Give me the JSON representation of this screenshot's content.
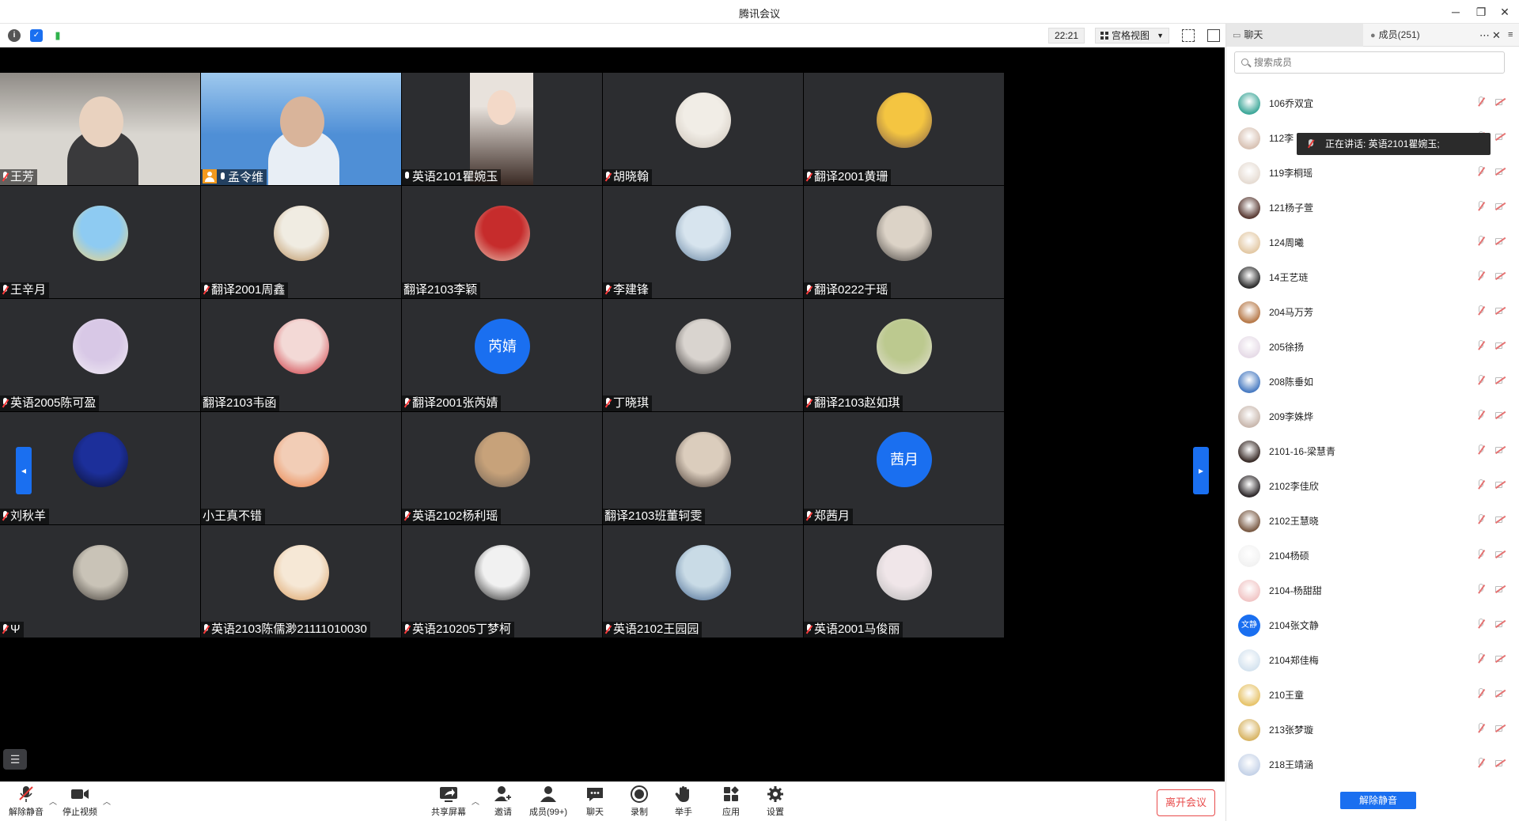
{
  "window": {
    "title": "腾讯会议"
  },
  "toolbar": {
    "clock": "22:21",
    "view_mode": "宫格视图"
  },
  "tiles": [
    {
      "name": "王芳",
      "mic": "off",
      "kind": "camera",
      "colors": [
        "#d9d6d0",
        "#8f8b86"
      ]
    },
    {
      "name": "孟令维",
      "mic": "on",
      "host": true,
      "kind": "camera",
      "colors": [
        "#4f8fd6",
        "#9fc9ee"
      ]
    },
    {
      "name": "英语2101瞿婉玉",
      "mic": "on",
      "kind": "camera",
      "active": true,
      "colors": [
        "#e8e2dc",
        "#3a2a24"
      ]
    },
    {
      "name": "胡晓翰",
      "mic": "off",
      "kind": "avatar",
      "colors": [
        "#f1ede6",
        "#c9bfb4"
      ]
    },
    {
      "name": "翻译2001黄珊",
      "mic": "off",
      "kind": "avatar",
      "colors": [
        "#f4c541",
        "#7b5a4a"
      ]
    },
    {
      "name": "王辛月",
      "mic": "off",
      "kind": "avatar",
      "colors": [
        "#8ecbf2",
        "#f6d57b"
      ]
    },
    {
      "name": "翻译2001周鑫",
      "mic": "off",
      "kind": "avatar",
      "colors": [
        "#f0ece2",
        "#b78a54"
      ]
    },
    {
      "name": "翻译2103李颖",
      "mic": "none",
      "kind": "avatar",
      "colors": [
        "#c62c2c",
        "#e9c9b8"
      ]
    },
    {
      "name": "李建锋",
      "mic": "off",
      "kind": "avatar",
      "colors": [
        "#d7e4ee",
        "#5b7b9a"
      ]
    },
    {
      "name": "翻译0222于瑶",
      "mic": "off",
      "kind": "avatar",
      "colors": [
        "#dcd3c7",
        "#3e3a37"
      ]
    },
    {
      "name": "英语2005陈可盈",
      "mic": "off",
      "kind": "avatar",
      "colors": [
        "#d8c8e6",
        "#f2eef4"
      ]
    },
    {
      "name": "翻译2103韦函",
      "mic": "none",
      "kind": "avatar",
      "colors": [
        "#f3d9d6",
        "#c8202a"
      ]
    },
    {
      "name": "翻译2001张芮婧",
      "mic": "off",
      "kind": "text",
      "text": "芮婧",
      "colors": [
        "#1a6ff0",
        "#1a6ff0"
      ]
    },
    {
      "name": "丁晓琪",
      "mic": "off",
      "kind": "avatar",
      "colors": [
        "#d9d4cf",
        "#2a2625"
      ]
    },
    {
      "name": "翻译2103赵如琪",
      "mic": "off",
      "kind": "avatar",
      "colors": [
        "#bcc98f",
        "#e8e2da"
      ]
    },
    {
      "name": "刘秋羊",
      "mic": "off",
      "kind": "avatar",
      "colors": [
        "#1c2f9a",
        "#0b0f2a"
      ]
    },
    {
      "name": "小王真不错",
      "mic": "none",
      "kind": "avatar",
      "colors": [
        "#f2cdb6",
        "#e9793c"
      ]
    },
    {
      "name": "英语2102杨利瑶",
      "mic": "off",
      "kind": "avatar",
      "colors": [
        "#c7a27a",
        "#6e6055"
      ]
    },
    {
      "name": "翻译2103班董轲雯",
      "mic": "none",
      "kind": "avatar",
      "colors": [
        "#dbcdbd",
        "#3b2d26"
      ]
    },
    {
      "name": "郑茜月",
      "mic": "off",
      "kind": "text",
      "text": "茜月",
      "colors": [
        "#1a6ff0",
        "#1a6ff0"
      ]
    },
    {
      "name": "Ψ",
      "mic": "off",
      "kind": "avatar",
      "colors": [
        "#c9c3b7",
        "#3a3530"
      ]
    },
    {
      "name": "英语2103陈儒渺21111010030",
      "mic": "off",
      "kind": "avatar",
      "colors": [
        "#f6e8d6",
        "#d99a5a"
      ]
    },
    {
      "name": "英语210205丁梦柯",
      "mic": "off",
      "kind": "avatar",
      "colors": [
        "#f1f1f1",
        "#151515"
      ]
    },
    {
      "name": "英语2102王园园",
      "mic": "off",
      "kind": "avatar",
      "colors": [
        "#c9dbe6",
        "#3b5e8a"
      ]
    },
    {
      "name": "英语2001马俊丽",
      "mic": "off",
      "kind": "avatar",
      "colors": [
        "#f0e6e9",
        "#b4b4b4"
      ]
    }
  ],
  "controls": {
    "unmute": "解除静音",
    "stop_video": "停止视频",
    "share": "共享屏幕",
    "invite": "邀请",
    "members": "成员(99+)",
    "chat": "聊天",
    "record": "录制",
    "raise_hand": "举手",
    "apps": "应用",
    "settings": "设置",
    "leave": "离开会议"
  },
  "panel": {
    "tab_chat": "聊天",
    "tab_members": "成员(251)",
    "search_placeholder": "搜索成员",
    "speaking_tooltip": "正在讲话: 英语2101瞿婉玉;",
    "unmute_all": "解除静音",
    "members": [
      {
        "name": "106乔双宜",
        "color": "#3fa89a"
      },
      {
        "name": "112李",
        "color": "#d8c2b4"
      },
      {
        "name": "119李桐瑶",
        "color": "#e6dcd3"
      },
      {
        "name": "121杨子萱",
        "color": "#5a3b34"
      },
      {
        "name": "124周曦",
        "color": "#e3c9a5"
      },
      {
        "name": "14王艺琏",
        "color": "#2d2d2d"
      },
      {
        "name": "204马万芳",
        "color": "#b77a4a"
      },
      {
        "name": "205徐扬",
        "color": "#e6dbe7"
      },
      {
        "name": "208陈垂如",
        "color": "#4a7cc2"
      },
      {
        "name": "209李姝烨",
        "color": "#c9b8ae"
      },
      {
        "name": "2101-16-梁慧青",
        "color": "#3b2e2a"
      },
      {
        "name": "2102李佳欣",
        "color": "#2f2a2c"
      },
      {
        "name": "2102王慧晓",
        "color": "#7b5c46"
      },
      {
        "name": "2104杨硕",
        "color": "#f2f2f2"
      },
      {
        "name": "2104-杨甜甜",
        "color": "#f1c6c6"
      },
      {
        "name": "2104张文静",
        "color": "#1a6ff0",
        "text": "文静"
      },
      {
        "name": "2104郑佳梅",
        "color": "#d5e3ef"
      },
      {
        "name": "210王童",
        "color": "#e7c46b"
      },
      {
        "name": "213张梦璇",
        "color": "#d8b565"
      },
      {
        "name": "218王靖涵",
        "color": "#c6d3e8"
      }
    ]
  }
}
